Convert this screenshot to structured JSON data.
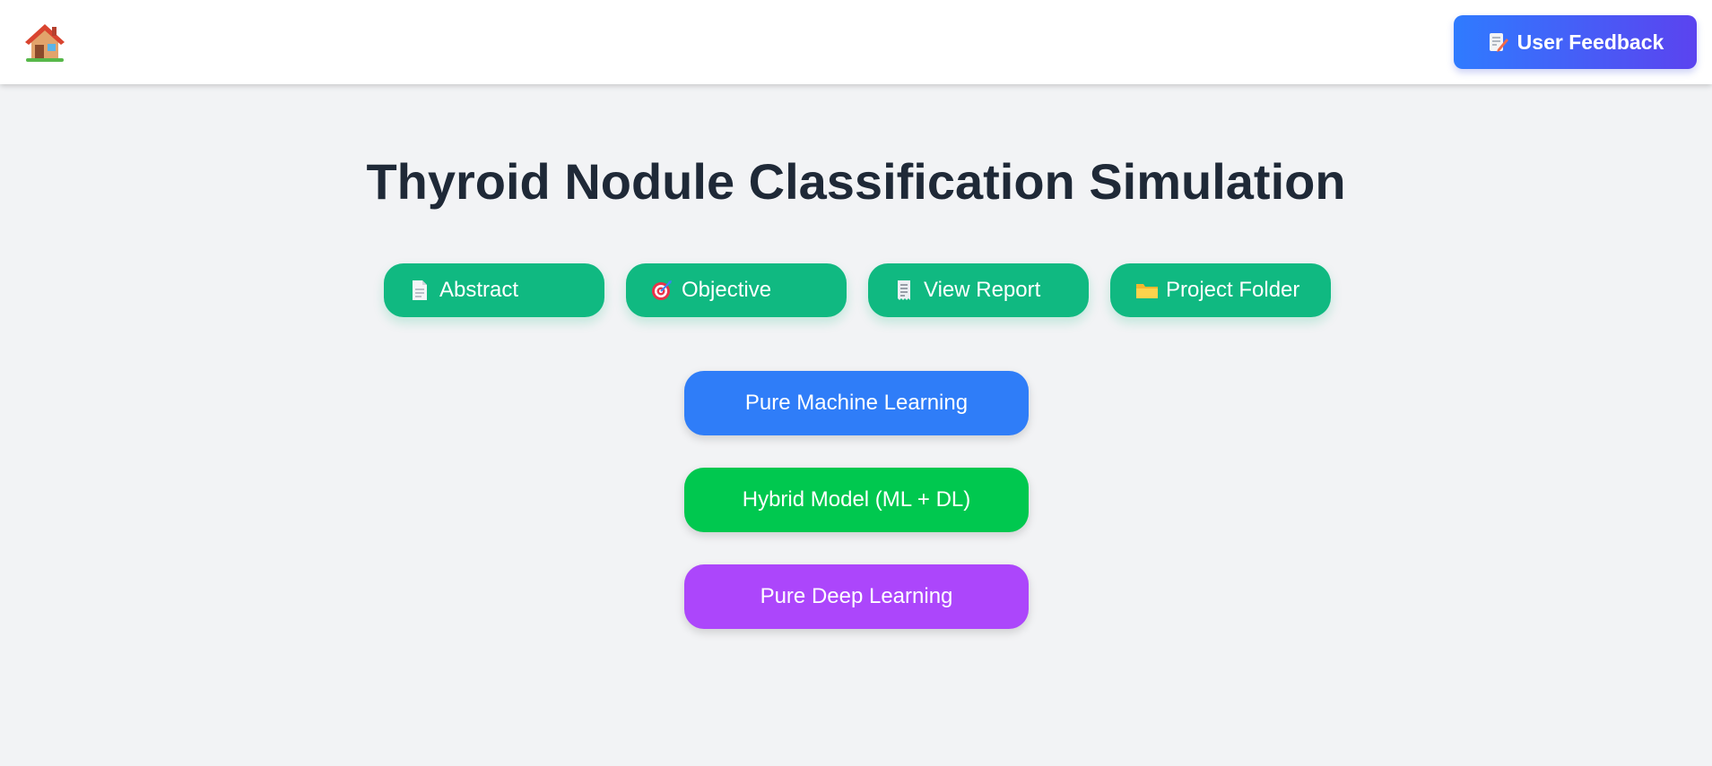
{
  "header": {
    "home_icon": "house-icon",
    "feedback_label": "User Feedback",
    "feedback_icon": "memo-pencil-icon"
  },
  "page": {
    "title": "Thyroid Nodule Classification Simulation"
  },
  "nav": {
    "items": [
      {
        "label": "Abstract",
        "icon": "document-icon"
      },
      {
        "label": "Objective",
        "icon": "target-icon"
      },
      {
        "label": "View Report",
        "icon": "receipt-icon"
      },
      {
        "label": "Project Folder",
        "icon": "folder-icon"
      }
    ]
  },
  "models": {
    "ml": {
      "label": "Pure Machine Learning",
      "color": "#2f7df8"
    },
    "hybrid": {
      "label": "Hybrid Model (ML + DL)",
      "color": "#00c84f"
    },
    "dl": {
      "label": "Pure Deep Learning",
      "color": "#ac46fb"
    }
  },
  "colors": {
    "nav_button": "#10b981",
    "title": "#1f2937",
    "feedback_gradient_start": "#2f7bff",
    "feedback_gradient_end": "#5b43ef"
  }
}
